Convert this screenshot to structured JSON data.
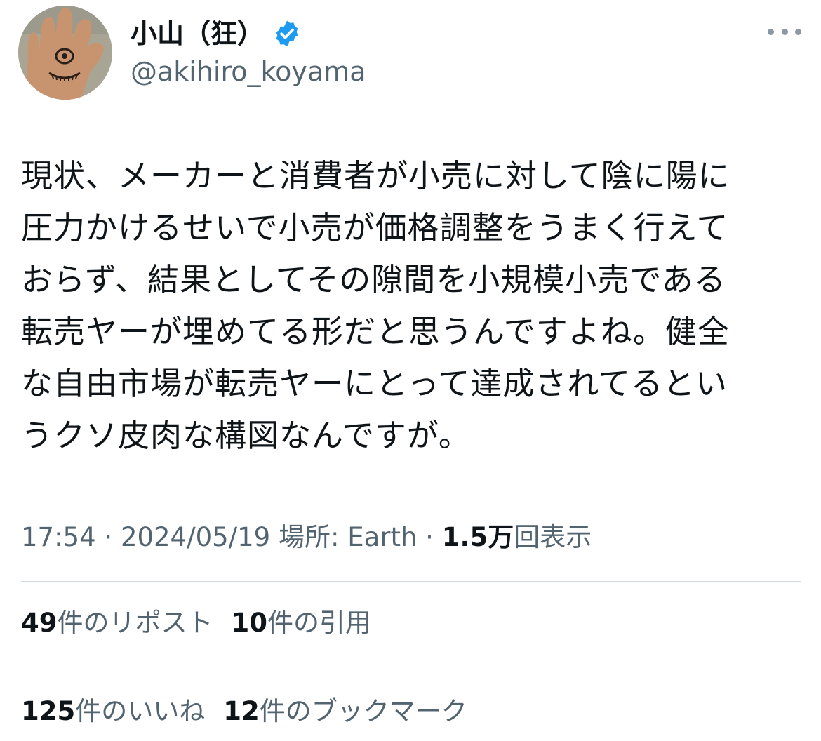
{
  "author": {
    "display_name": "小山（狂）",
    "handle": "@akihiro_koyama",
    "verified": true,
    "verified_color": "#1d9bf0"
  },
  "more_icon": "more-horizontal-icon",
  "tweet": {
    "lines": [
      "現状、メーカーと消費者が小売に対して陰に陽に",
      "圧力かけるせいで小売が価格調整をうまく行えて",
      "おらず、結果としてその隙間を小規模小売である",
      "転売ヤーが埋めてる形だと思うんですよね。健全",
      "な自由市場が転売ヤーにとって達成されてるとい",
      "うクソ皮肉な構図なんですが。"
    ]
  },
  "meta": {
    "time": "17:54",
    "sep1": " · ",
    "date": "2024/05/19",
    "location": " 場所: Earth",
    "sep2": " · ",
    "views_count": "1.5万",
    "views_label": "回表示"
  },
  "stats": {
    "reposts_count": "49",
    "reposts_label": "件のリポスト",
    "quotes_count": "10",
    "quotes_label": "件の引用",
    "likes_count": "125",
    "likes_label": "件のいいね",
    "bookmarks_count": "12",
    "bookmarks_label": "件のブックマーク"
  }
}
